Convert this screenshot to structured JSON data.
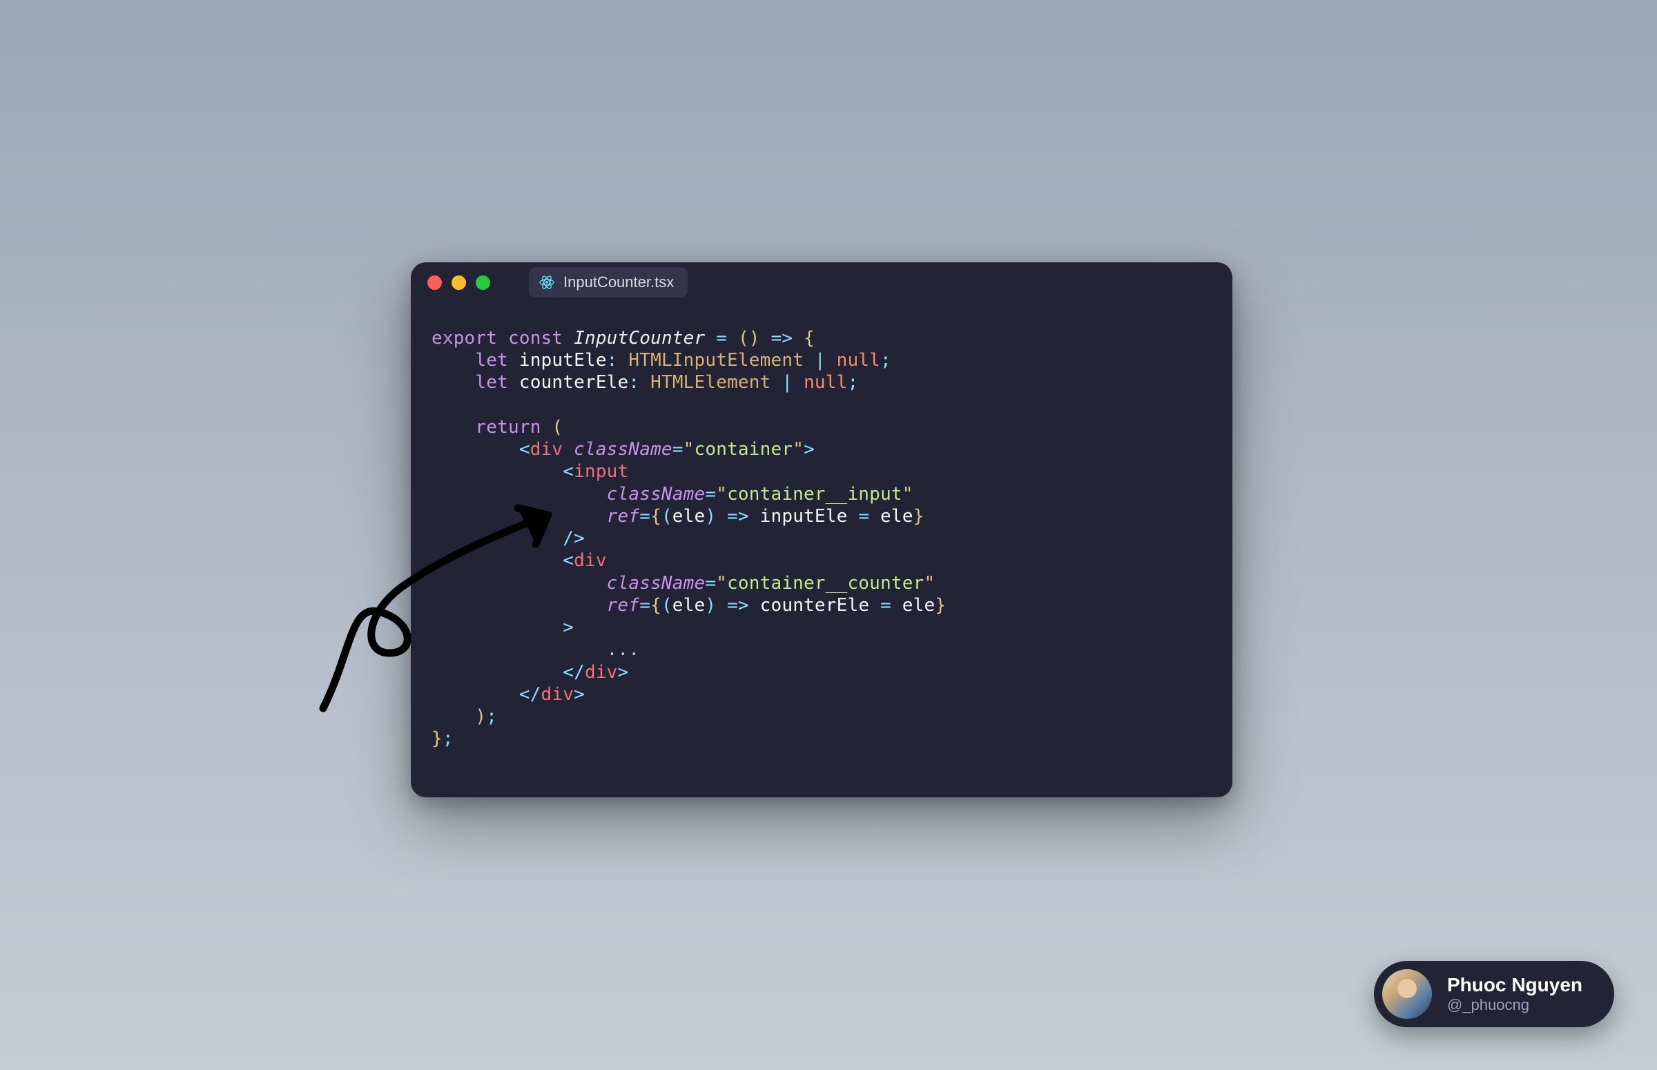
{
  "window": {
    "filename": "InputCounter.tsx"
  },
  "code": {
    "l1": {
      "export": "export",
      "const": "const",
      "name": "InputCounter",
      "eq": " = ",
      "parens": "()",
      "arrow": " => ",
      "brace": "{"
    },
    "l2": {
      "let": "let",
      "var": "inputEle",
      "colon": ": ",
      "type": "HTMLInputElement",
      "pipe": " | ",
      "null": "null",
      "semi": ";"
    },
    "l3": {
      "let": "let",
      "var": "counterEle",
      "colon": ": ",
      "type": "HTMLElement",
      "pipe": " | ",
      "null": "null",
      "semi": ";"
    },
    "l5": {
      "return": "return",
      "paren": " ("
    },
    "l6": {
      "lt": "<",
      "tag": "div",
      "sp": " ",
      "attr": "className",
      "eq": "=",
      "q1": "\"",
      "str": "container",
      "q2": "\"",
      "gt": ">"
    },
    "l7": {
      "lt": "<",
      "tag": "input"
    },
    "l8": {
      "attr": "className",
      "eq": "=",
      "q1": "\"",
      "str": "container__input",
      "q2": "\""
    },
    "l9": {
      "attr": "ref",
      "eq": "=",
      "b1": "{",
      "p1": "(",
      "ele": "ele",
      "p2": ")",
      "arrow": " => ",
      "lhs": "inputEle",
      "asg": " = ",
      "rhs": "ele",
      "b2": "}"
    },
    "l10": {
      "slash": "/",
      "gt": ">"
    },
    "l11": {
      "lt": "<",
      "tag": "div"
    },
    "l12": {
      "attr": "className",
      "eq": "=",
      "q1": "\"",
      "str": "container__counter",
      "q2": "\""
    },
    "l13": {
      "attr": "ref",
      "eq": "=",
      "b1": "{",
      "p1": "(",
      "ele": "ele",
      "p2": ")",
      "arrow": " => ",
      "lhs": "counterEle",
      "asg": " = ",
      "rhs": "ele",
      "b2": "}"
    },
    "l14": {
      "gt": ">"
    },
    "l15": {
      "dots": "..."
    },
    "l16": {
      "lt": "<",
      "slash": "/",
      "tag": "div",
      "gt": ">"
    },
    "l17": {
      "lt": "<",
      "slash": "/",
      "tag": "div",
      "gt": ">"
    },
    "l18": {
      "paren": ")",
      "semi": ";"
    },
    "l19": {
      "brace": "}",
      "semi": ";"
    }
  },
  "author": {
    "name": "Phuoc Nguyen",
    "handle": "@_phuocng"
  }
}
